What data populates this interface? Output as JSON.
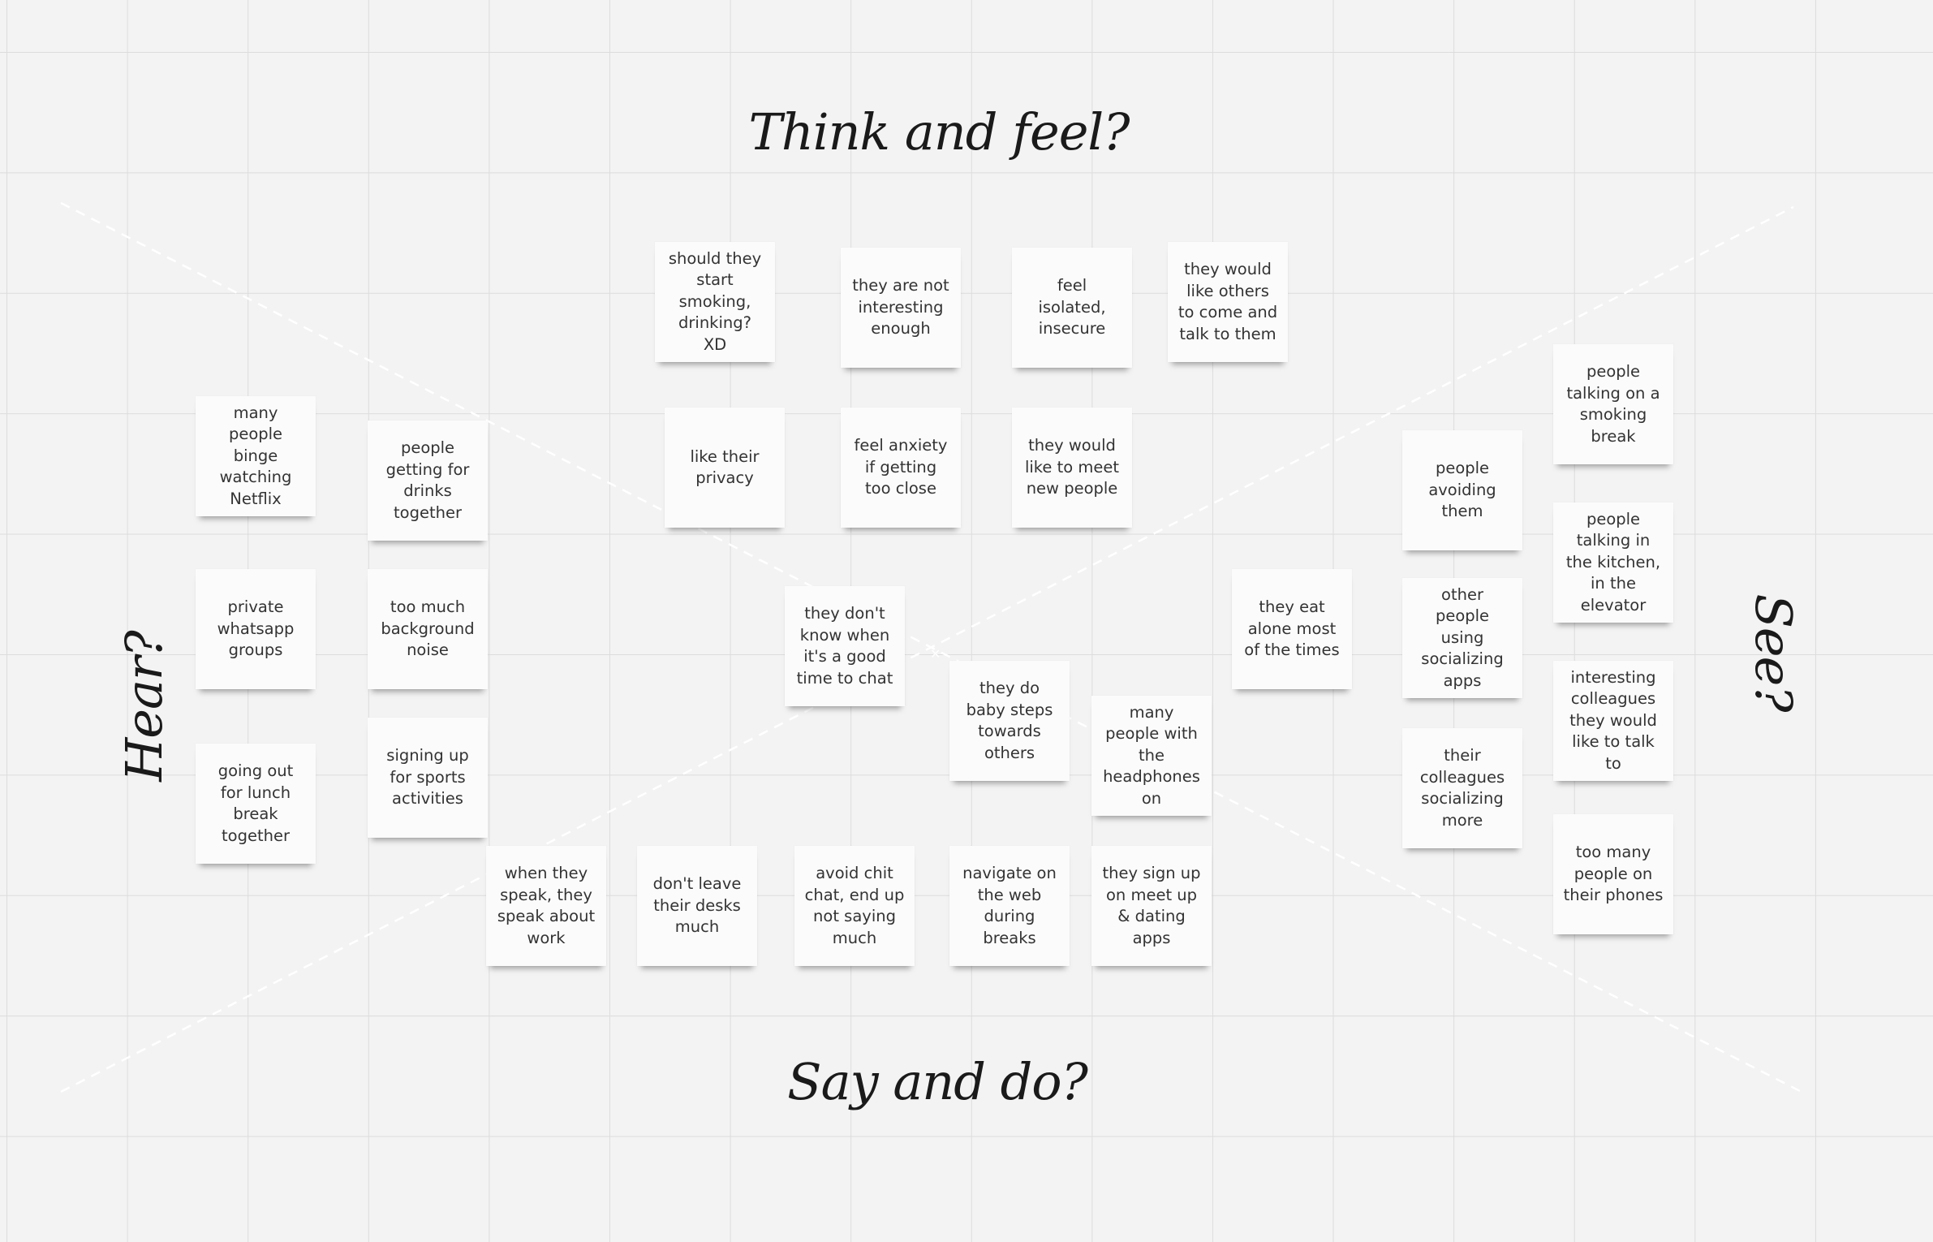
{
  "board": {
    "headings": {
      "top": "Think and feel?",
      "bottom": "Say and do?",
      "left": "Hear?",
      "right": "See?"
    },
    "colors": {
      "sticky_background": "#fbfbfb",
      "board_background": "#f3f3f3",
      "grid_line": "#dcdcdc",
      "heading_text": "#1a1a1a",
      "sticky_text": "#333333",
      "diagonal_line": "#ffffff"
    }
  },
  "think_feel_notes": [
    "should they start smoking, drinking? XD",
    "they are not interesting enough",
    "feel isolated, insecure",
    "they would like others to come and talk to them",
    "like their privacy",
    "feel anxiety if getting too close",
    "they would like to meet new people"
  ],
  "hear_notes": [
    "many people binge watching Netflix",
    "people getting for drinks together",
    "private whatsapp groups",
    "too much background noise",
    "going out for lunch break together",
    "signing up for sports activities"
  ],
  "center_notes": [
    "they don't know when it's a good time to chat",
    "they do baby steps towards others",
    "many people with the headphones on",
    "they eat alone most of the times"
  ],
  "say_do_notes": [
    "when they speak, they speak about work",
    "don't leave their desks much",
    "avoid chit chat, end up not saying much",
    "navigate on the web during breaks",
    "they sign up on meet up & dating apps"
  ],
  "see_notes": [
    "people avoiding them",
    "other people using socializing apps",
    "their colleagues socializing more",
    "people talking on a smoking break",
    "people talking in the kitchen, in the elevator",
    "interesting colleagues they would like to talk to",
    "too many people on their phones"
  ]
}
